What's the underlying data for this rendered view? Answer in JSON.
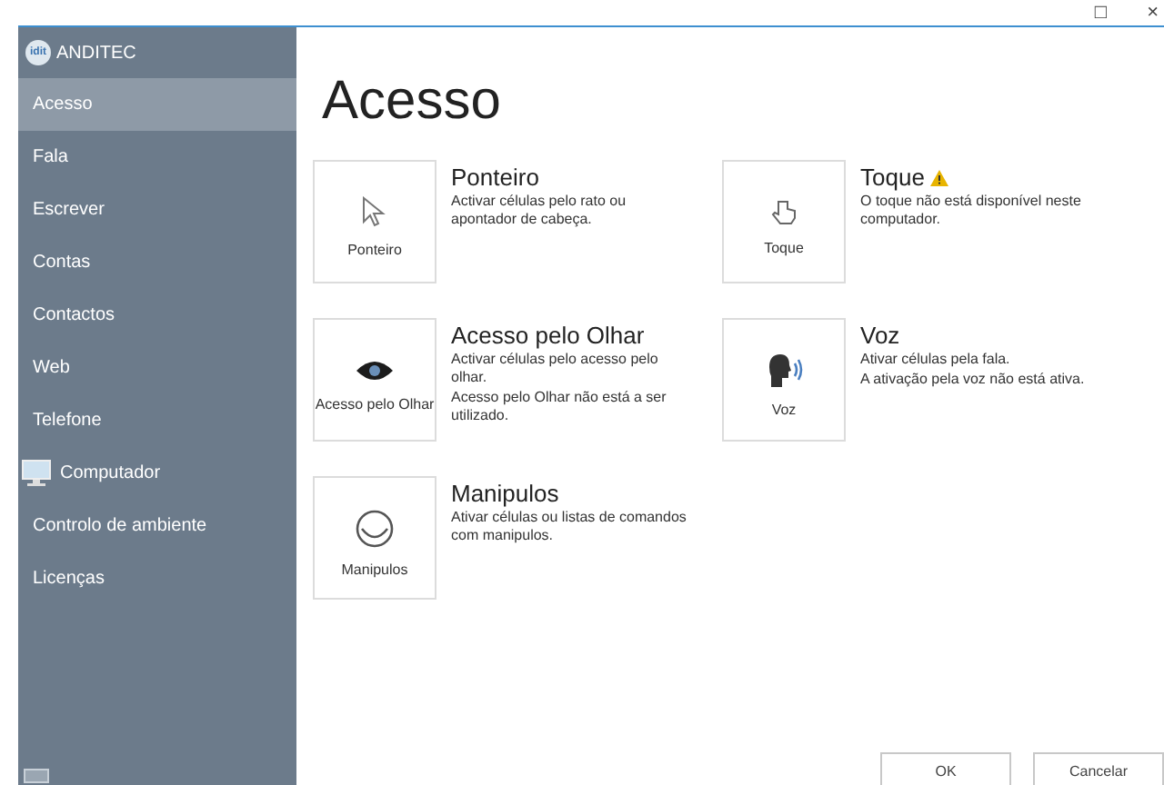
{
  "window": {
    "controls": [
      "□",
      "×"
    ]
  },
  "sidebar": {
    "brand": "ANDITEC",
    "logo": "idit",
    "items": [
      {
        "label": "Acesso",
        "selected": true,
        "kind": "text"
      },
      {
        "label": "Fala",
        "selected": false,
        "kind": "text"
      },
      {
        "label": "Escrever",
        "selected": false,
        "kind": "text"
      },
      {
        "label": "Contas",
        "selected": false,
        "kind": "text"
      },
      {
        "label": "Contactos",
        "selected": false,
        "kind": "text"
      },
      {
        "label": "Web",
        "selected": false,
        "kind": "text"
      },
      {
        "label": "Telefone",
        "selected": false,
        "kind": "text"
      },
      {
        "label": "Computador",
        "selected": false,
        "kind": "computer"
      },
      {
        "label": "Controlo de ambiente",
        "selected": false,
        "kind": "text"
      },
      {
        "label": "Licenças",
        "selected": false,
        "kind": "text"
      }
    ]
  },
  "page_title": "Acesso",
  "methods": [
    {
      "kind": "pointer",
      "tile_label": "Ponteiro",
      "title": "Ponteiro",
      "warning": false,
      "description": [
        "Activar células pelo rato ou apontador de cabeça."
      ]
    },
    {
      "kind": "touch",
      "tile_label": "Toque",
      "title": "Toque",
      "warning": true,
      "description": [
        "O toque não está disponível neste computador."
      ]
    },
    {
      "kind": "eye",
      "tile_label": "Acesso pelo Olhar",
      "title": "Acesso pelo Olhar",
      "warning": false,
      "description": [
        "Activar células pelo acesso pelo olhar.",
        "Acesso pelo Olhar não está a ser utilizado."
      ]
    },
    {
      "kind": "voice",
      "tile_label": "Voz",
      "title": "Voz",
      "warning": false,
      "description": [
        "Ativar células pela fala.",
        "A ativação pela voz não está ativa."
      ]
    },
    {
      "kind": "switch",
      "tile_label": "Manipulos",
      "title": "Manipulos",
      "warning": false,
      "description": [
        "Ativar células ou listas de comandos com manipulos."
      ]
    }
  ],
  "buttons": [
    "OK",
    "Cancelar"
  ]
}
